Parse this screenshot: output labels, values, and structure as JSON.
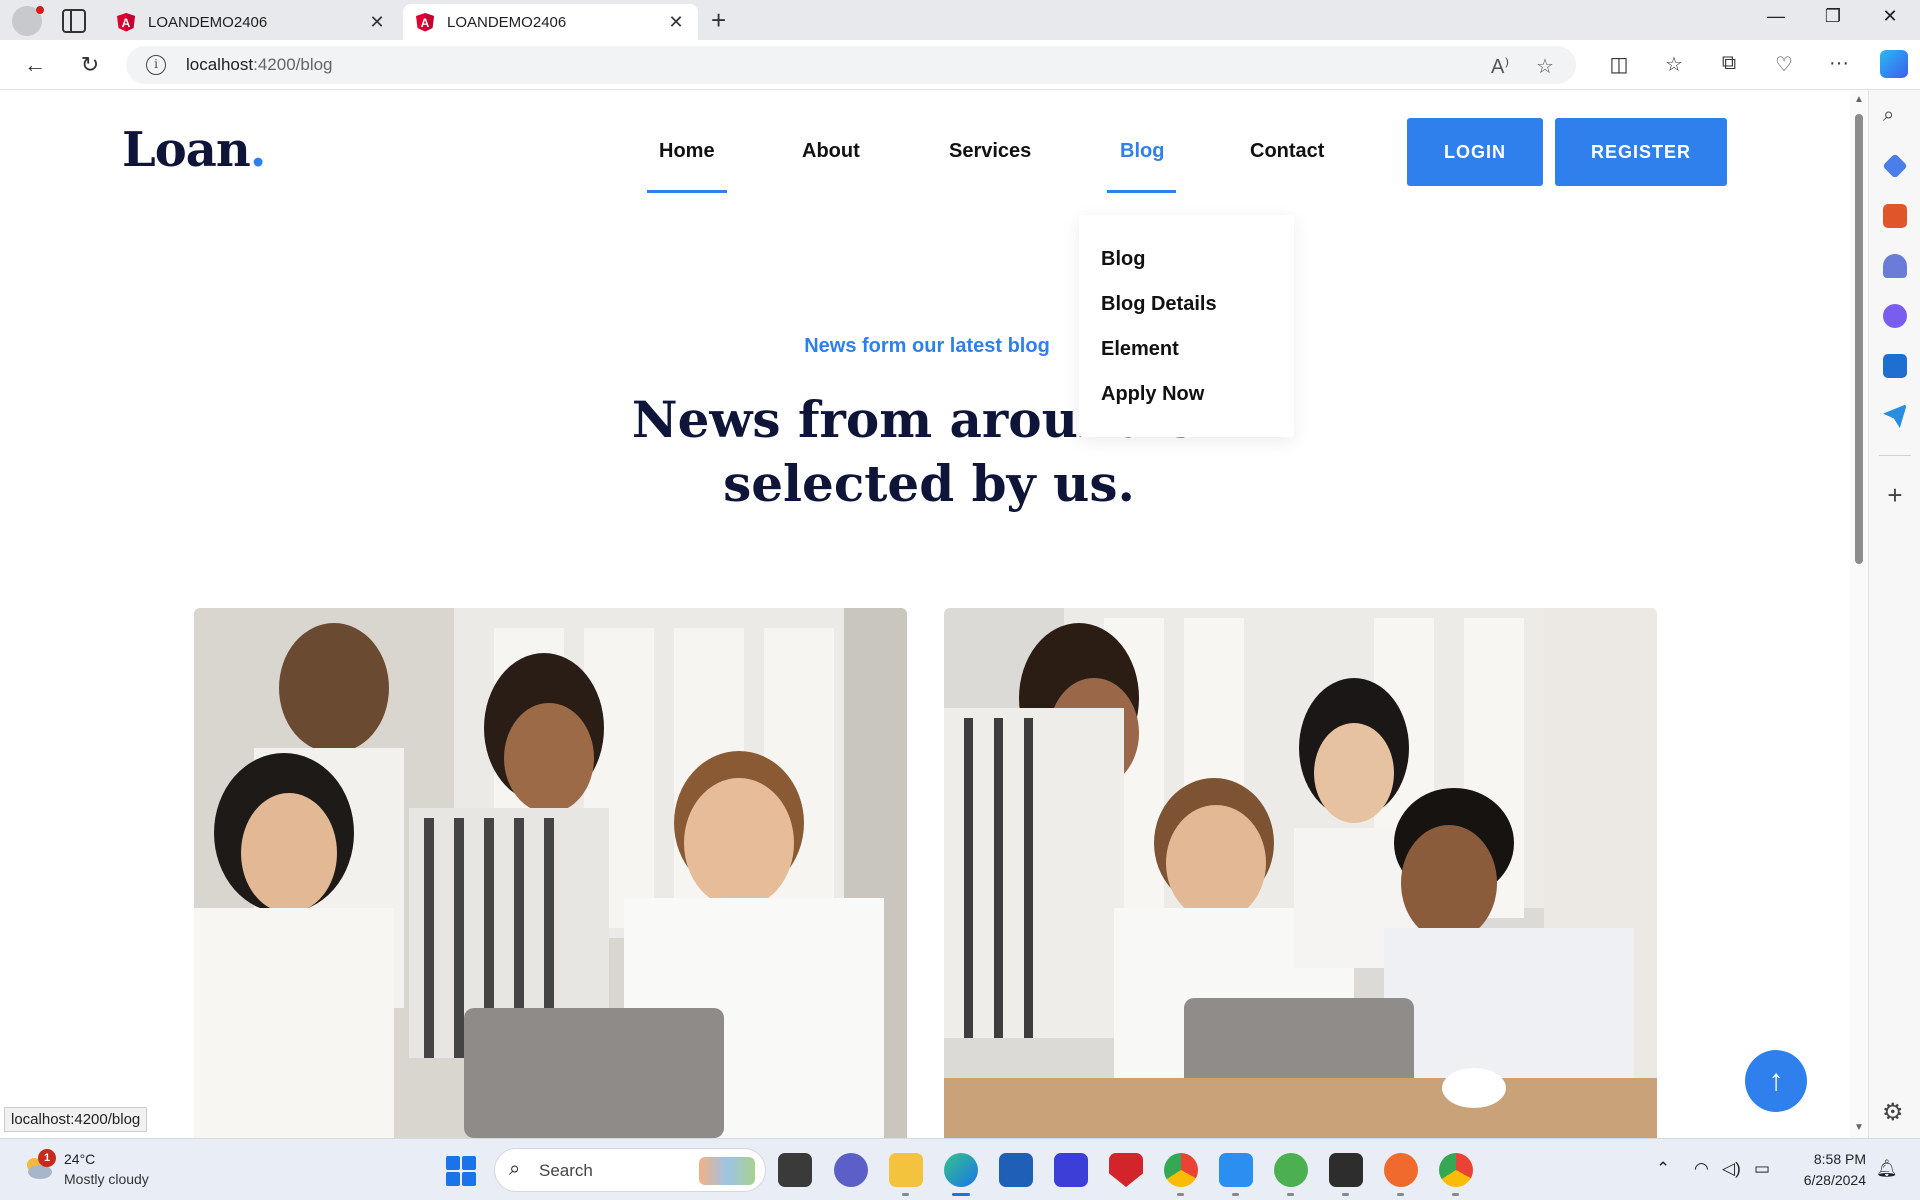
{
  "browser": {
    "tabs": [
      {
        "title": "LOANDEMO2406",
        "active": false
      },
      {
        "title": "LOANDEMO2406",
        "active": true
      }
    ],
    "url_host": "localhost",
    "url_path": ":4200/blog",
    "status_url": "localhost:4200/blog"
  },
  "site": {
    "logo_text": "Loan",
    "logo_dot": ".",
    "nav": [
      {
        "label": "Home",
        "active_underline": true
      },
      {
        "label": "About"
      },
      {
        "label": "Services"
      },
      {
        "label": "Blog",
        "current": true
      },
      {
        "label": "Contact"
      }
    ],
    "login_label": "LOGIN",
    "register_label": "REGISTER",
    "dropdown": [
      "Blog",
      "Blog Details",
      "Element",
      "Apply Now"
    ],
    "subheading": "News form our latest blog",
    "heading": "News from around the world selected by us.",
    "heading_visible_line1": "News from around th",
    "heading_visible_line2": "selected by us.",
    "scroll_top_icon": "arrow-up-icon",
    "accent_color": "#2f80ed",
    "heading_color": "#0e1538"
  },
  "taskbar": {
    "weather_badge": "1",
    "weather_temp": "24°C",
    "weather_desc": "Mostly cloudy",
    "search_label": "Search",
    "time": "8:58 PM",
    "date": "6/28/2024"
  }
}
